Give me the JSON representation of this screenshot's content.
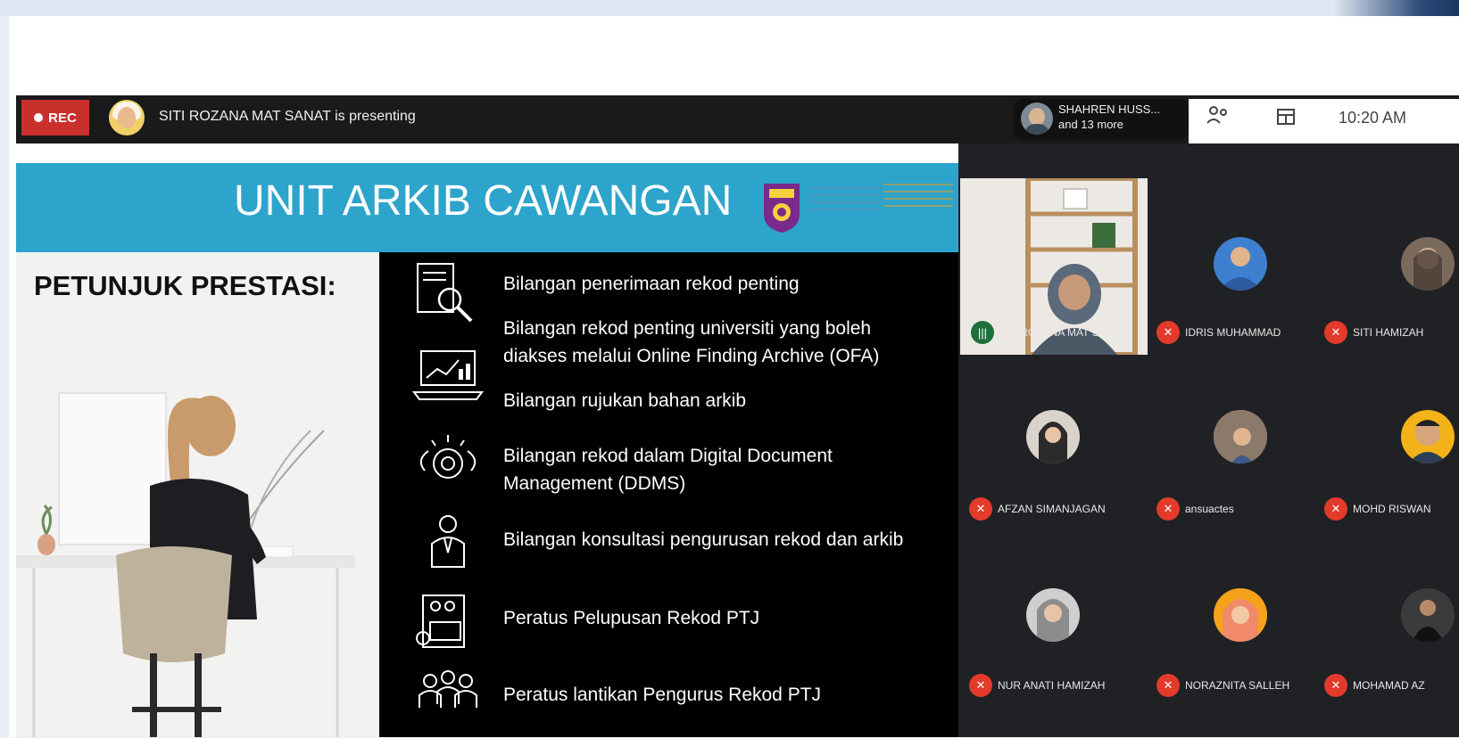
{
  "meeting": {
    "rec_label": "REC",
    "presenting_text": "SITI ROZANA MAT SANAT is presenting",
    "people": {
      "name": "SHAHREN HUSS...",
      "more": "and 13 more"
    },
    "clock": "10:20 AM"
  },
  "slide": {
    "title": "UNIT ARKIB CAWANGAN",
    "heading": "PETUNJUK PRESTASI:",
    "items": [
      {
        "text": "Bilangan  penerimaan rekod penting",
        "icon": "document-search-icon"
      },
      {
        "text": "Bilangan rekod penting universiti yang boleh diakses melalui Online Finding Archive (OFA)",
        "icon": "laptop-chart-icon"
      },
      {
        "text": "Bilangan  rujukan bahan arkib",
        "icon": ""
      },
      {
        "text": "Bilangan rekod dalam Digital Document Management (DDMS)",
        "icon": "gear-cloud-icon"
      },
      {
        "text": "Bilangan konsultasi pengurusan rekod dan arkib",
        "icon": "consultant-icon"
      },
      {
        "text": "Peratus Pelupusan Rekod PTJ",
        "icon": "report-icon"
      },
      {
        "text": "Peratus lantikan Pengurus Rekod PTJ",
        "icon": "team-icon"
      }
    ]
  },
  "participants": [
    {
      "name": "SITI ROZANA MAT SA...",
      "video": true
    },
    {
      "name": "IDRIS MUHAMMAD",
      "color": "#3f7fd0"
    },
    {
      "name": "SITI HAMIZAH",
      "color": "#7a6a5c"
    },
    {
      "name": "AFZAN SIMANJAGAN",
      "color": "#d9d3cc"
    },
    {
      "name": "ansuactes",
      "color": "#b9a89a"
    },
    {
      "name": "MOHD RISWAN",
      "color": "#f4b21a"
    },
    {
      "name": "NUR ANATI HAMIZAH",
      "color": "#cfcfcf"
    },
    {
      "name": "NORAZNITA SALLEH",
      "color": "#f7a21b"
    },
    {
      "name": "MOHAMAD AZ",
      "color": "#3b3b3b"
    }
  ]
}
